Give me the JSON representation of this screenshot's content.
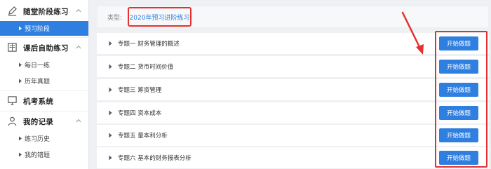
{
  "sidebar": {
    "groups": [
      {
        "title": "随堂阶段练习",
        "icon": "pen-icon"
      },
      {
        "title": "课后自助练习",
        "icon": "book-icon"
      },
      {
        "title": "机考系统",
        "icon": "monitor-icon"
      },
      {
        "title": "我的记录",
        "icon": "user-icon"
      }
    ],
    "items": [
      {
        "label": "预习阶段"
      },
      {
        "label": "每日一练"
      },
      {
        "label": "历年真题"
      },
      {
        "label": "练习历史"
      },
      {
        "label": "我的错题"
      }
    ]
  },
  "filter": {
    "label": "类型:",
    "value": "2020年预习进阶练习"
  },
  "topics": [
    {
      "label": "专题一 财务管理的概述"
    },
    {
      "label": "专题二 货币时间价值"
    },
    {
      "label": "专题三 筹资管理"
    },
    {
      "label": "专题四 资本成本"
    },
    {
      "label": "专题五 量本利分析"
    },
    {
      "label": "专题六 基本的财务报表分析"
    }
  ],
  "start_button_label": "开始做题",
  "colors": {
    "accent": "#2f7fe0",
    "annotation": "#e5302e"
  }
}
